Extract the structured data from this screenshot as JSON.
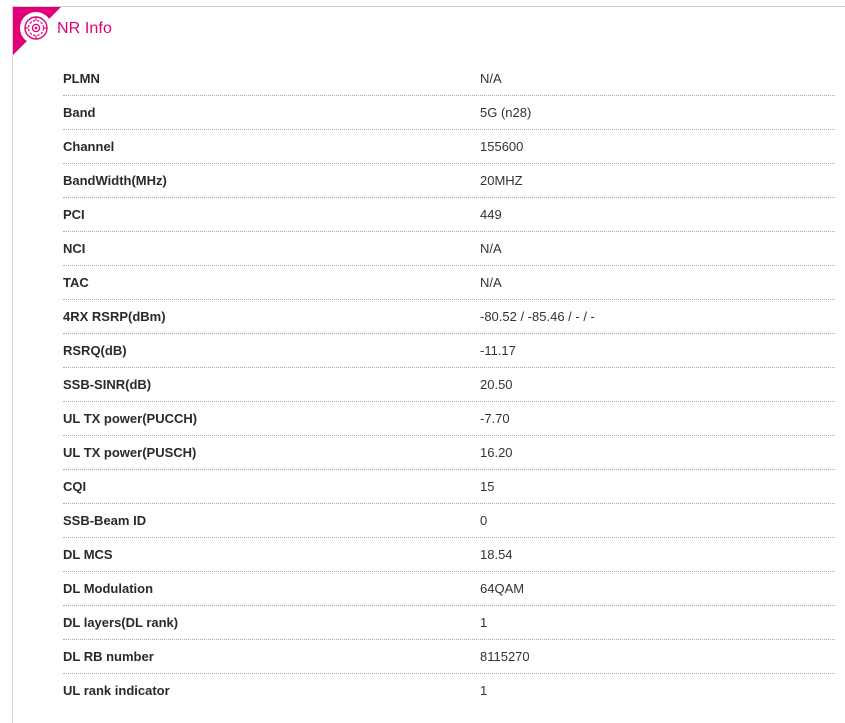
{
  "panel": {
    "title": "NR Info",
    "icon": "nr-signal-icon",
    "accent_color": "#e2007a"
  },
  "rows": [
    {
      "label": "PLMN",
      "value": "N/A"
    },
    {
      "label": "Band",
      "value": "5G (n28)"
    },
    {
      "label": "Channel",
      "value": "155600"
    },
    {
      "label": "BandWidth(MHz)",
      "value": "20MHZ"
    },
    {
      "label": "PCI",
      "value": "449"
    },
    {
      "label": "NCI",
      "value": "N/A"
    },
    {
      "label": "TAC",
      "value": "N/A"
    },
    {
      "label": "4RX RSRP(dBm)",
      "value": "-80.52 / -85.46 / - / -"
    },
    {
      "label": "RSRQ(dB)",
      "value": "-11.17"
    },
    {
      "label": "SSB-SINR(dB)",
      "value": "20.50"
    },
    {
      "label": "UL TX power(PUCCH)",
      "value": "-7.70"
    },
    {
      "label": "UL TX power(PUSCH)",
      "value": "16.20"
    },
    {
      "label": "CQI",
      "value": "15"
    },
    {
      "label": "SSB-Beam ID",
      "value": "0"
    },
    {
      "label": "DL MCS",
      "value": "18.54"
    },
    {
      "label": "DL Modulation",
      "value": "64QAM"
    },
    {
      "label": "DL layers(DL rank)",
      "value": "1"
    },
    {
      "label": "DL RB number",
      "value": "8115270"
    },
    {
      "label": "UL rank indicator",
      "value": "1"
    }
  ]
}
